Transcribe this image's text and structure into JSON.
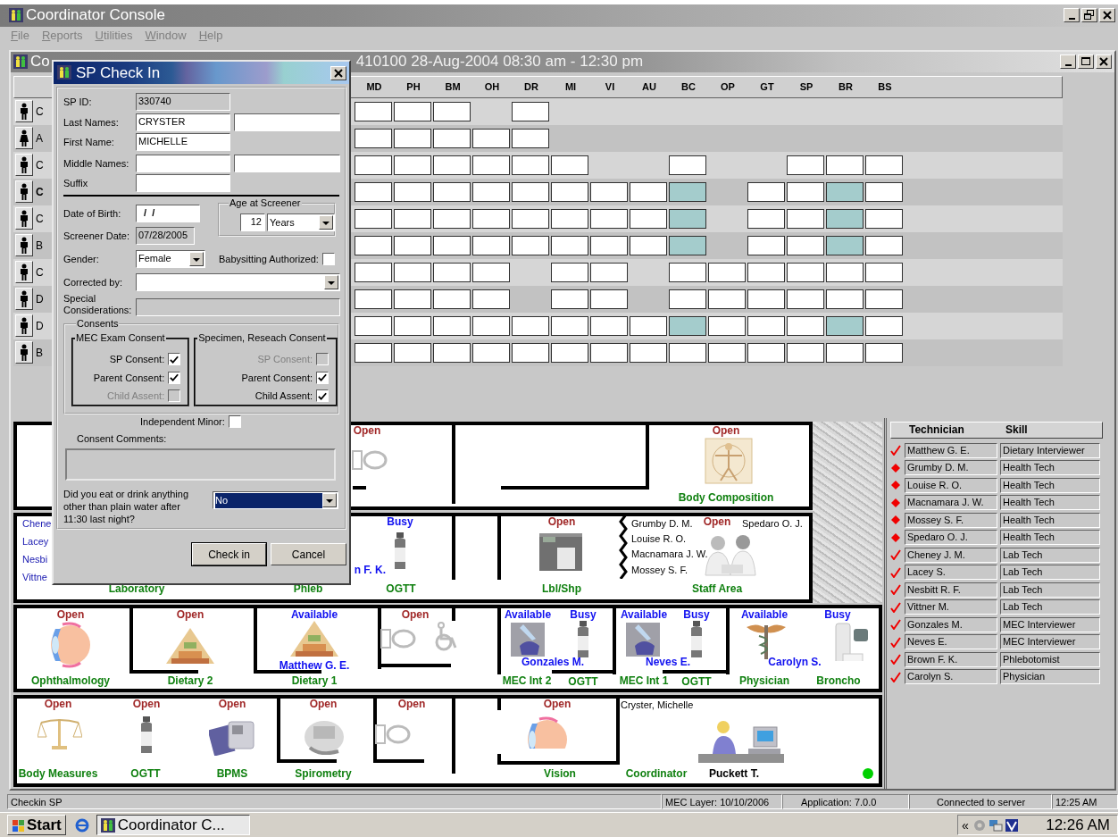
{
  "window": {
    "title": "Coordinator Console"
  },
  "menu": [
    "File",
    "Reports",
    "Utilities",
    "Window",
    "Help"
  ],
  "session_window": {
    "title_start": "Co",
    "title_end": "410100 28-Aug-2004 08:30 am - 12:30 pm"
  },
  "grid": {
    "columns": [
      "MD",
      "PH",
      "BM",
      "OH",
      "DR",
      "MI",
      "VI",
      "AU",
      "BC",
      "OP",
      "GT",
      "SP",
      "BR",
      "BS"
    ],
    "rows": [
      {
        "initial": "C",
        "kind": "male",
        "selected": false,
        "cells": [
          {
            "kind": "pending"
          },
          {
            "kind": "pending"
          },
          {
            "kind": "pending"
          },
          {
            "kind": "none"
          },
          {
            "kind": "pending"
          },
          {
            "kind": "none"
          },
          {
            "kind": "none"
          },
          {
            "kind": "none"
          },
          {
            "kind": "none"
          },
          {
            "kind": "none"
          },
          {
            "kind": "none"
          },
          {
            "kind": "none"
          },
          {
            "kind": "none"
          },
          {
            "kind": "none"
          }
        ]
      },
      {
        "initial": "A",
        "kind": "female",
        "selected": false,
        "cells": [
          {
            "kind": "pending"
          },
          {
            "kind": "pending"
          },
          {
            "kind": "pending"
          },
          {
            "kind": "pending"
          },
          {
            "kind": "pending"
          },
          {
            "kind": "none"
          },
          {
            "kind": "none"
          },
          {
            "kind": "none"
          },
          {
            "kind": "none"
          },
          {
            "kind": "none"
          },
          {
            "kind": "none"
          },
          {
            "kind": "none"
          },
          {
            "kind": "none"
          },
          {
            "kind": "none"
          }
        ]
      },
      {
        "initial": "C",
        "kind": "male",
        "selected": false,
        "cells": [
          {
            "kind": "pending"
          },
          {
            "kind": "pending"
          },
          {
            "kind": "pending"
          },
          {
            "kind": "pending"
          },
          {
            "kind": "pending"
          },
          {
            "kind": "pending"
          },
          {
            "kind": "none"
          },
          {
            "kind": "none"
          },
          {
            "kind": "pending"
          },
          {
            "kind": "none"
          },
          {
            "kind": "none"
          },
          {
            "kind": "pending"
          },
          {
            "kind": "pending"
          },
          {
            "kind": "pending"
          }
        ]
      },
      {
        "initial": "C",
        "kind": "male",
        "selected": true,
        "cells": [
          {
            "kind": "pending"
          },
          {
            "kind": "pending"
          },
          {
            "kind": "pending"
          },
          {
            "kind": "pending"
          },
          {
            "kind": "pending"
          },
          {
            "kind": "pending"
          },
          {
            "kind": "pending"
          },
          {
            "kind": "pending"
          },
          {
            "kind": "done"
          },
          {
            "kind": "none"
          },
          {
            "kind": "pending"
          },
          {
            "kind": "pending"
          },
          {
            "kind": "done"
          },
          {
            "kind": "pending"
          }
        ]
      },
      {
        "initial": "C",
        "kind": "male",
        "selected": false,
        "cells": [
          {
            "kind": "pending"
          },
          {
            "kind": "pending"
          },
          {
            "kind": "pending"
          },
          {
            "kind": "pending"
          },
          {
            "kind": "pending"
          },
          {
            "kind": "pending"
          },
          {
            "kind": "pending"
          },
          {
            "kind": "pending"
          },
          {
            "kind": "done"
          },
          {
            "kind": "none"
          },
          {
            "kind": "pending"
          },
          {
            "kind": "pending"
          },
          {
            "kind": "done"
          },
          {
            "kind": "pending"
          }
        ]
      },
      {
        "initial": "B",
        "kind": "male",
        "selected": false,
        "cells": [
          {
            "kind": "pending"
          },
          {
            "kind": "pending"
          },
          {
            "kind": "pending"
          },
          {
            "kind": "pending"
          },
          {
            "kind": "pending"
          },
          {
            "kind": "pending"
          },
          {
            "kind": "pending"
          },
          {
            "kind": "pending"
          },
          {
            "kind": "done"
          },
          {
            "kind": "none"
          },
          {
            "kind": "pending"
          },
          {
            "kind": "pending"
          },
          {
            "kind": "done"
          },
          {
            "kind": "pending"
          }
        ]
      },
      {
        "initial": "C",
        "kind": "male",
        "selected": false,
        "cells": [
          {
            "kind": "pending"
          },
          {
            "kind": "pending"
          },
          {
            "kind": "pending"
          },
          {
            "kind": "pending"
          },
          {
            "kind": "none"
          },
          {
            "kind": "pending"
          },
          {
            "kind": "pending"
          },
          {
            "kind": "none"
          },
          {
            "kind": "pending"
          },
          {
            "kind": "pending"
          },
          {
            "kind": "pending"
          },
          {
            "kind": "pending"
          },
          {
            "kind": "pending"
          },
          {
            "kind": "pending"
          }
        ]
      },
      {
        "initial": "D",
        "kind": "male",
        "selected": false,
        "cells": [
          {
            "kind": "pending"
          },
          {
            "kind": "pending"
          },
          {
            "kind": "pending"
          },
          {
            "kind": "pending"
          },
          {
            "kind": "none"
          },
          {
            "kind": "pending"
          },
          {
            "kind": "pending"
          },
          {
            "kind": "none"
          },
          {
            "kind": "pending"
          },
          {
            "kind": "pending"
          },
          {
            "kind": "pending"
          },
          {
            "kind": "pending"
          },
          {
            "kind": "pending"
          },
          {
            "kind": "pending"
          }
        ]
      },
      {
        "initial": "D",
        "kind": "male",
        "selected": false,
        "cells": [
          {
            "kind": "pending"
          },
          {
            "kind": "pending"
          },
          {
            "kind": "pending"
          },
          {
            "kind": "pending"
          },
          {
            "kind": "pending"
          },
          {
            "kind": "pending"
          },
          {
            "kind": "pending"
          },
          {
            "kind": "pending"
          },
          {
            "kind": "done"
          },
          {
            "kind": "pending"
          },
          {
            "kind": "pending"
          },
          {
            "kind": "pending"
          },
          {
            "kind": "done"
          },
          {
            "kind": "pending"
          }
        ]
      },
      {
        "initial": "B",
        "kind": "male",
        "selected": false,
        "cells": [
          {
            "kind": "pending"
          },
          {
            "kind": "pending"
          },
          {
            "kind": "pending"
          },
          {
            "kind": "pending"
          },
          {
            "kind": "pending"
          },
          {
            "kind": "pending"
          },
          {
            "kind": "pending"
          },
          {
            "kind": "pending"
          },
          {
            "kind": "pending"
          },
          {
            "kind": "pending"
          },
          {
            "kind": "pending"
          },
          {
            "kind": "pending"
          },
          {
            "kind": "pending"
          },
          {
            "kind": "pending"
          }
        ]
      }
    ]
  },
  "floor_plan": {
    "rooms": [
      {
        "status": "Open",
        "kind": "open"
      },
      {
        "status": "Open",
        "kind": "open",
        "name": "Body Composition"
      },
      {
        "name": "Laboratory",
        "occupants": [
          "Chene",
          "Lacey",
          "Nesbi",
          "Vittne"
        ]
      },
      {
        "name": "Phleb",
        "occupant": "n F. K."
      },
      {
        "status": "Busy",
        "kind": "busy",
        "name": "OGTT"
      },
      {
        "status": "Open",
        "kind": "open",
        "name": "Lbl/Shp"
      },
      {
        "status": "Open",
        "kind": "open",
        "name": "Staff Area",
        "occupants": [
          "Grumby D. M.",
          "Louise R. O.",
          "Macnamara J. W.",
          "Mossey S. F.",
          "Spedaro O. J."
        ]
      },
      {
        "status": "Open",
        "kind": "open",
        "name": "Ophthalmology"
      },
      {
        "status": "Open",
        "kind": "open",
        "name": "Dietary 2"
      },
      {
        "status": "Available",
        "kind": "available",
        "name": "Dietary 1",
        "occupant": "Matthew G. E."
      },
      {
        "status": "Open",
        "kind": "open"
      },
      {
        "status": "Available",
        "kind": "available",
        "name": "MEC Int 2",
        "occupant": "Gonzales M."
      },
      {
        "status": "Busy",
        "kind": "busy",
        "name": "OGTT"
      },
      {
        "status": "Available",
        "kind": "available",
        "name": "MEC Int 1",
        "occupant": "Neves E."
      },
      {
        "status": "Busy",
        "kind": "busy",
        "name": "OGTT"
      },
      {
        "status": "Available",
        "kind": "available",
        "name": "Physician",
        "occupant": "Carolyn S."
      },
      {
        "status": "Busy",
        "kind": "busy",
        "name": "Broncho"
      },
      {
        "status": "Open",
        "kind": "open",
        "name": "Body Measures"
      },
      {
        "status": "Open",
        "kind": "open",
        "name": "OGTT"
      },
      {
        "status": "Open",
        "kind": "open",
        "name": "BPMS"
      },
      {
        "status": "Open",
        "kind": "open",
        "name": "Spirometry"
      },
      {
        "status": "Open",
        "kind": "open"
      },
      {
        "status": "Open",
        "kind": "open",
        "name": "Vision"
      },
      {
        "name": "Coordinator",
        "patient": "Cryster, Michelle",
        "occupant": "Puckett T."
      }
    ]
  },
  "technicians": {
    "columns": [
      "Technician",
      "Skill"
    ],
    "rows": [
      {
        "name": "Matthew G. E.",
        "skill": "Dietary Interviewer",
        "in_staff_area": false
      },
      {
        "name": "Grumby D. M.",
        "skill": "Health Tech",
        "in_staff_area": true
      },
      {
        "name": "Louise R. O.",
        "skill": "Health Tech",
        "in_staff_area": true
      },
      {
        "name": "Macnamara J. W.",
        "skill": "Health Tech",
        "in_staff_area": true
      },
      {
        "name": "Mossey S. F.",
        "skill": "Health Tech",
        "in_staff_area": true
      },
      {
        "name": "Spedaro O. J.",
        "skill": "Health Tech",
        "in_staff_area": true
      },
      {
        "name": "Cheney J. M.",
        "skill": "Lab Tech",
        "in_staff_area": false
      },
      {
        "name": "Lacey S.",
        "skill": "Lab Tech",
        "in_staff_area": false
      },
      {
        "name": "Nesbitt R. F.",
        "skill": "Lab Tech",
        "in_staff_area": false
      },
      {
        "name": "Vittner M.",
        "skill": "Lab Tech",
        "in_staff_area": false
      },
      {
        "name": "Gonzales M.",
        "skill": "MEC Interviewer",
        "in_staff_area": false
      },
      {
        "name": "Neves E.",
        "skill": "MEC Interviewer",
        "in_staff_area": false
      },
      {
        "name": "Brown F. K.",
        "skill": "Phlebotomist",
        "in_staff_area": false
      },
      {
        "name": "Carolyn S.",
        "skill": "Physician",
        "in_staff_area": false
      }
    ]
  },
  "dialog": {
    "title": "SP Check In",
    "sp_id": {
      "label": "SP ID:",
      "value": "330740"
    },
    "name_fields": [
      {
        "label": "Last Names:",
        "kind": "double",
        "value": "CRYSTER"
      },
      {
        "label": "First Name:",
        "kind": "single",
        "value": "MICHELLE"
      },
      {
        "label": "Middle Names:",
        "kind": "double"
      },
      {
        "label": "Suffix",
        "kind": "single"
      }
    ],
    "dob": {
      "label": "Date of Birth:",
      "value": "/  /"
    },
    "age": {
      "title": "Age at Screener",
      "value": "12",
      "unit": "Years"
    },
    "screener_date": {
      "label": "Screener Date:",
      "value": "07/28/2005"
    },
    "gender": {
      "label": "Gender:",
      "value": "Female"
    },
    "babysitting": {
      "label": "Babysitting Authorized:",
      "checked": false
    },
    "corrected_by": {
      "label": "Corrected by:"
    },
    "special": {
      "label": "Special Considerations:"
    },
    "consents": {
      "title": "Consents",
      "groups": [
        {
          "title": "MEC Exam Consent",
          "items": [
            {
              "label": "SP Consent:",
              "checked": true,
              "disabled": false
            },
            {
              "label": "Parent Consent:",
              "checked": true,
              "disabled": false
            },
            {
              "label": "Child Assent:",
              "checked": false,
              "disabled": true
            }
          ]
        },
        {
          "title": "Specimen, Reseach Consent",
          "items": [
            {
              "label": "SP Consent:",
              "checked": false,
              "disabled": true
            },
            {
              "label": "Parent Consent:",
              "checked": true,
              "disabled": false
            },
            {
              "label": "Child Assent:",
              "checked": true,
              "disabled": false
            }
          ]
        }
      ]
    },
    "independent_minor": {
      "label": "Independent Minor:",
      "checked": false
    },
    "comments_label": "Consent Comments:",
    "question": {
      "text": "Did you eat or drink anything other than plain water after 11:30 last night?",
      "value": "No"
    },
    "buttons": [
      {
        "label": "Check in",
        "default": true
      },
      {
        "label": "Cancel",
        "default": false
      }
    ]
  },
  "status_bar": [
    "Checkin SP",
    "MEC Layer: 10/10/2006",
    "Application: 7.0.0",
    "Connected to server",
    "12:25 AM"
  ],
  "taskbar": {
    "start": "Start",
    "task": {
      "label": "Coordinator C...",
      "selected": true
    },
    "tray_toggle": "«",
    "clock": "12:26 AM"
  }
}
